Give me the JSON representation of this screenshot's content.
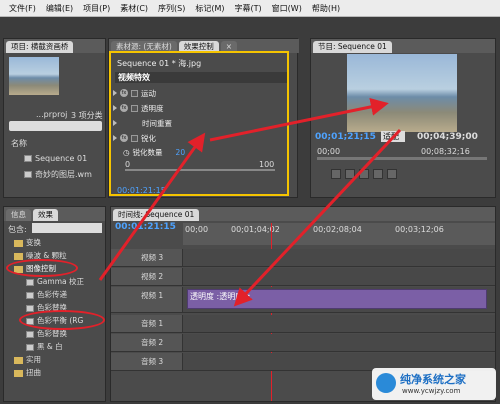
{
  "menu": [
    "文件(F)",
    "编辑(E)",
    "项目(P)",
    "素材(C)",
    "序列(S)",
    "标记(M)",
    "字幕(T)",
    "窗口(W)",
    "帮助(H)"
  ],
  "project": {
    "tab": "项目: 横截资画桥",
    "filename": "...prproj",
    "count": "3 项分类",
    "col_name": "名称",
    "items": [
      "Sequence 01",
      "奇妙的图层.wm"
    ]
  },
  "source_tabs": {
    "source": "素材源: (无素材)",
    "effect": "效果控制",
    "close": "×"
  },
  "effect_control": {
    "header": "Sequence 01 * 海.jpg",
    "section": "视频特效",
    "rows": [
      "运动",
      "透明度",
      "时间重置",
      "锐化"
    ],
    "sharpen_label": "锐化数量",
    "sharpen_value": "20",
    "zero": "0",
    "max": "100",
    "timecode": "00:01:21:15"
  },
  "program": {
    "tab": "节目: Sequence 01",
    "timecode": "00;01;21;15",
    "fit": "适配",
    "duration": "00;04;39;00",
    "ruler_a": "00;00",
    "ruler_b": "00;08;32;16"
  },
  "effects_panel": {
    "tab_info": "信息",
    "tab_effects": "效果",
    "search_label": "包含:",
    "items": [
      "变换",
      "噪波 & 颗粒",
      "图像控制",
      "Gamma 校正",
      "色彩传递",
      "色彩替换",
      "色彩平衡 (RG",
      "色彩替换",
      "黑 & 白",
      "实用",
      "扭曲"
    ]
  },
  "timeline": {
    "tab": "时间线: Sequence 01",
    "timecode": "00:01:21:15",
    "marks": [
      "00;00",
      "00;01;04;02",
      "00;02;08;04",
      "00;03;12;06"
    ],
    "tracks": [
      "视频 3",
      "视频 2",
      "视频 1",
      "音频 1",
      "音频 2",
      "音频 3"
    ],
    "clip_label": "海.jpg",
    "clip_fx": "透明度 :透明度 ▾"
  },
  "watermark": {
    "title": "纯净系统之家",
    "url": "www.ycwjzy.com"
  },
  "colors": {
    "accent_blue": "#4ea3ff",
    "highlight": "#f5c400",
    "annotation_red": "#e2212a",
    "clip_purple": "#7b5fa6"
  }
}
